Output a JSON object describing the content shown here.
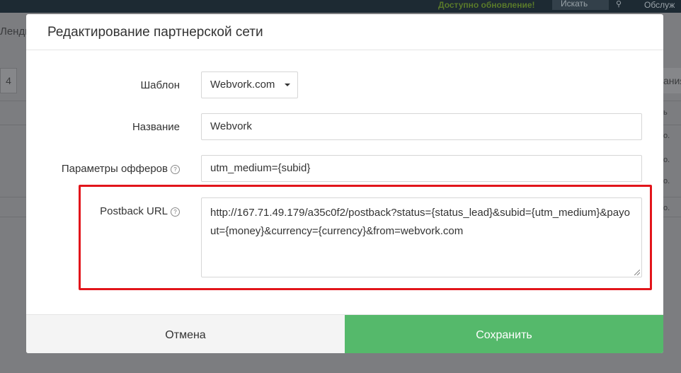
{
  "background": {
    "update_notice": "Доступно обновление!",
    "search_placeholder": "Искать",
    "service_link": "Обслуж",
    "left_tab_text": "Ленди",
    "left_box_text": "4",
    "right_button_text": "ания",
    "right_cells": [
      "ь",
      "о.",
      "о.",
      "о.",
      "о."
    ]
  },
  "modal": {
    "title": "Редактирование партнерской сети",
    "template_label": "Шаблон",
    "template_value": "Webvork.com",
    "name_label": "Название",
    "name_value": "Webvork",
    "offer_params_label": "Параметры офферов",
    "offer_params_value": "utm_medium={subid}",
    "postback_label": "Postback URL",
    "postback_value": "http://167.71.49.179/a35c0f2/postback?status={status_lead}&subid={utm_medium}&payout={money}&currency={currency}&from=webvork.com",
    "help_icon_glyph": "?",
    "cancel_label": "Отмена",
    "save_label": "Сохранить"
  },
  "colors": {
    "save_button": "#55b96b",
    "highlight_border": "#e2151b",
    "overlay": "#7f8083"
  }
}
